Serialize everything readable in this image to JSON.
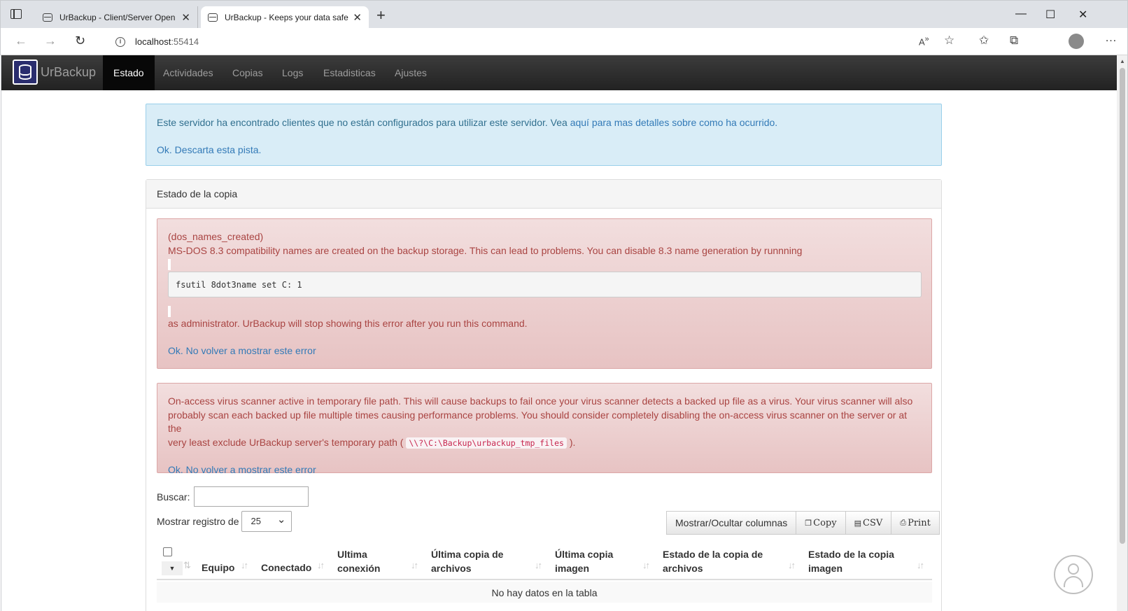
{
  "browser": {
    "tabs": [
      {
        "label": "UrBackup - Client/Server Open S",
        "close": "✕"
      },
      {
        "label": "UrBackup - Keeps your data safe",
        "close": "✕"
      }
    ],
    "new_tab": "+",
    "window_buttons": {
      "minimize": "—",
      "maximize": "☐",
      "close": "✕"
    },
    "url_host": "localhost",
    "url_port": ":55414"
  },
  "app": {
    "brand": "UrBackup",
    "nav": [
      "Estado",
      "Actividades",
      "Copias",
      "Logs",
      "Estadisticas",
      "Ajustes"
    ],
    "active_nav": "Estado"
  },
  "info_alert": {
    "text": "Este servidor ha encontrado clientes que no están configurados para utilizar este servidor. Vea ",
    "link": "aquí para mas detalles sobre como ha ocurrido.",
    "dismiss": "Ok. Descarta esta pista."
  },
  "panel": {
    "heading": "Estado de la copia",
    "error1": {
      "code_name": "(dos_names_created)",
      "message": "MS-DOS 8.3 compatibility names are created on the backup storage. This can lead to problems. You can disable 8.3 name generation by runnning",
      "command": "fsutil 8dot3name set C: 1",
      "after": "as administrator. UrBackup will stop showing this error after you run this command.",
      "dismiss": "Ok. No volver a mostrar este error"
    },
    "error2": {
      "message_line1": "On-access virus scanner active in temporary file path. This will cause backups to fail once your virus scanner detects a backed up file as a virus. Your virus scanner will also",
      "message_line2": "probably scan each backed up file multiple times causing performance problems. You should consider completely disabling the on-access virus scanner on the server or at the",
      "message_line3": "very least exclude UrBackup server's temporary path ( ",
      "path": "\\\\?\\C:\\Backup\\urbackup_tmp_files",
      "message_end": " ).",
      "dismiss": "Ok. No volver a mostrar este error"
    },
    "search_label": "Buscar:",
    "length_label": "Mostrar registro de",
    "length_value": "25",
    "buttons": [
      "Mostrar/Ocultar columnas",
      "Copy",
      "CSV",
      "Print"
    ],
    "columns": [
      {
        "l1": "Equipo",
        "l2": ""
      },
      {
        "l1": "Conectado",
        "l2": ""
      },
      {
        "l1": "Ultima",
        "l2": "conexión"
      },
      {
        "l1": "Última copia de",
        "l2": "archivos"
      },
      {
        "l1": "Última copia",
        "l2": "imagen"
      },
      {
        "l1": "Estado de la copia de",
        "l2": "archivos"
      },
      {
        "l1": "Estado de la copia",
        "l2": "imagen"
      }
    ],
    "empty_text": "No hay datos en la tabla"
  }
}
